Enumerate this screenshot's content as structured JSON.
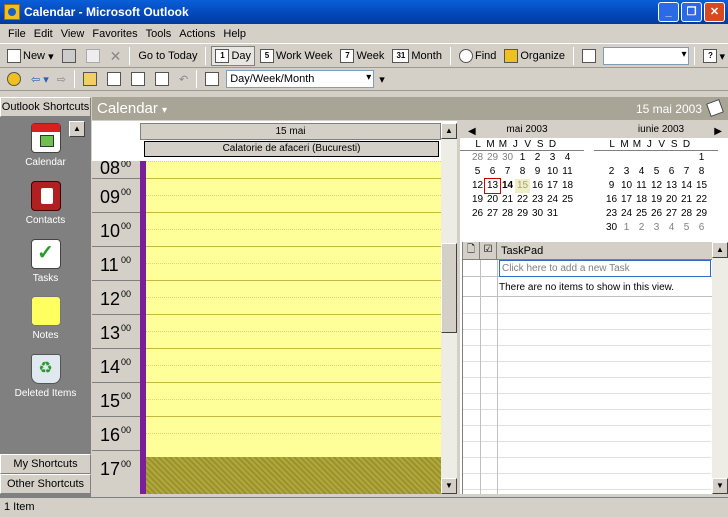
{
  "window": {
    "title": "Calendar - Microsoft Outlook",
    "controls": [
      "_",
      "❐",
      "✕"
    ]
  },
  "menu": [
    "File",
    "Edit",
    "View",
    "Favorites",
    "Tools",
    "Actions",
    "Help"
  ],
  "toolbar1": {
    "new_label": "New",
    "go_today_label": "Go to Today",
    "day_label": "Day",
    "work_week_label": "Work Week",
    "week_label": "Week",
    "month_label": "Month",
    "find_label": "Find",
    "organize_label": "Organize",
    "day_icon_num": "1",
    "work_week_icon_num": "5",
    "week_icon_num": "7",
    "month_icon_num": "31"
  },
  "toolbar2": {
    "view_combo": "Day/Week/Month"
  },
  "shortcuts": {
    "header": "Outlook Shortcuts",
    "items": [
      "Calendar",
      "Contacts",
      "Tasks",
      "Notes",
      "Deleted Items"
    ],
    "my_shortcuts": "My Shortcuts",
    "other_shortcuts": "Other Shortcuts"
  },
  "calendar": {
    "title": "Calendar",
    "date": "15 mai 2003",
    "day_header": "15 mai",
    "event": "Calatorie de afaceri (Bucuresti)",
    "hours": [
      "08",
      "09",
      "10",
      "11",
      "12",
      "13",
      "14",
      "15",
      "16",
      "17"
    ],
    "minutes": "00"
  },
  "date_navigator": {
    "months": [
      {
        "name": "mai 2003",
        "dow": [
          "L",
          "M",
          "M",
          "J",
          "V",
          "S",
          "D"
        ],
        "weeks": [
          [
            "28",
            "29",
            "30",
            "1",
            "2",
            "3",
            "4"
          ],
          [
            "5",
            "6",
            "7",
            "8",
            "9",
            "10",
            "11"
          ],
          [
            "12",
            "13",
            "14",
            "15",
            "16",
            "17",
            "18"
          ],
          [
            "19",
            "20",
            "21",
            "22",
            "23",
            "24",
            "25"
          ],
          [
            "26",
            "27",
            "28",
            "29",
            "30",
            "31",
            ""
          ]
        ]
      },
      {
        "name": "iunie 2003",
        "dow": [
          "L",
          "M",
          "M",
          "J",
          "V",
          "S",
          "D"
        ],
        "weeks": [
          [
            "",
            "",
            "",
            "",
            "",
            "",
            "1"
          ],
          [
            "2",
            "3",
            "4",
            "5",
            "6",
            "7",
            "8"
          ],
          [
            "9",
            "10",
            "11",
            "12",
            "13",
            "14",
            "15"
          ],
          [
            "16",
            "17",
            "18",
            "19",
            "20",
            "21",
            "22"
          ],
          [
            "23",
            "24",
            "25",
            "26",
            "27",
            "28",
            "29"
          ],
          [
            "30",
            "1",
            "2",
            "3",
            "4",
            "5",
            "6"
          ]
        ]
      }
    ]
  },
  "taskpad": {
    "title": "TaskPad",
    "new_task_placeholder": "Click here to add a new Task",
    "empty_message": "There are no items to show in this view."
  },
  "status": {
    "text": "1 Item"
  }
}
